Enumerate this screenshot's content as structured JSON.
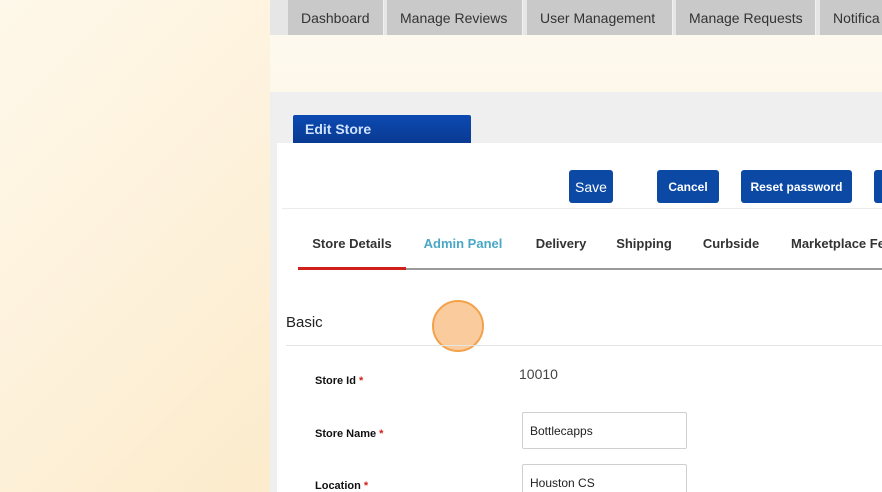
{
  "top_nav": {
    "tabs": [
      {
        "label": "Dashboard"
      },
      {
        "label": "Manage Reviews"
      },
      {
        "label": "User Management"
      },
      {
        "label": "Manage Requests"
      },
      {
        "label": "Notifica"
      }
    ]
  },
  "header": {
    "title": "Edit Store"
  },
  "toolbar": {
    "save_label": "Save",
    "cancel_label": "Cancel",
    "reset_label": "Reset password"
  },
  "tabs": [
    {
      "label": "Store Details",
      "active": true
    },
    {
      "label": "Admin Panel",
      "hover": true
    },
    {
      "label": "Delivery"
    },
    {
      "label": "Shipping"
    },
    {
      "label": "Curbside"
    },
    {
      "label": "Marketplace Fe"
    }
  ],
  "section": {
    "title": "Basic"
  },
  "fields": {
    "store_id": {
      "label": "Store Id",
      "required": "*",
      "value": "10010"
    },
    "store_name": {
      "label": "Store Name",
      "required": "*",
      "value": "Bottlecapps"
    },
    "location": {
      "label": "Location",
      "required": "*",
      "value": "Houston CS"
    }
  },
  "colors": {
    "primary_button": "#0b49a5",
    "header_blue": "#0a3a92",
    "active_tab_underline": "#d0201a",
    "tab_hover_text": "#4aa7c6",
    "required_asterisk": "#d0201a"
  }
}
